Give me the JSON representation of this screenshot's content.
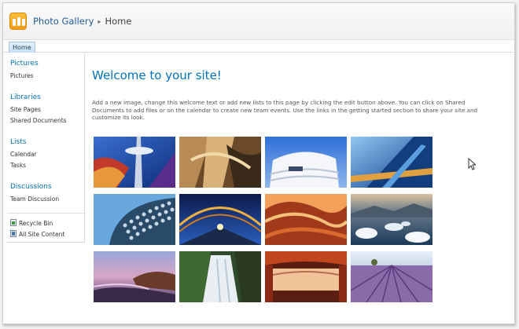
{
  "header": {
    "site_title": "Photo Gallery",
    "separator": "▸",
    "current_page": "Home",
    "logo_icon": "photo-gallery-icon"
  },
  "topnav": {
    "home_tab": "Home"
  },
  "sidebar": {
    "sections": [
      {
        "heading": "Pictures",
        "items": [
          "Pictures"
        ]
      },
      {
        "heading": "Libraries",
        "items": [
          "Site Pages",
          "Shared Documents"
        ]
      },
      {
        "heading": "Lists",
        "items": [
          "Calendar",
          "Tasks"
        ]
      },
      {
        "heading": "Discussions",
        "items": [
          "Team Discussion"
        ]
      }
    ],
    "footer": [
      {
        "label": "Recycle Bin",
        "icon": "recycle-bin-icon"
      },
      {
        "label": "All Site Content",
        "icon": "all-site-content-icon"
      }
    ]
  },
  "main": {
    "title": "Welcome to your site!",
    "body": "Add a new image, change this welcome text or add new lists to this page by clicking the edit button above. You can click on Shared Documents to add files or on the calendar to create new team events. Use the links in the getting started section to share your site and customize its look."
  },
  "gallery": {
    "rows": 3,
    "cols": 4,
    "photos": [
      "space-needle",
      "abstract-architecture",
      "white-curved-building",
      "blue-glass-building",
      "selfridges-facade",
      "illuminated-bridge",
      "red-rock-wave",
      "icebergs-lake",
      "rocky-coast-sunset",
      "waterfall",
      "desert-arch",
      "lavender-field"
    ]
  },
  "colors": {
    "accent": "#0072bc",
    "logo_orange": "#f3a322",
    "tab_blue": "#c9e0f6"
  }
}
